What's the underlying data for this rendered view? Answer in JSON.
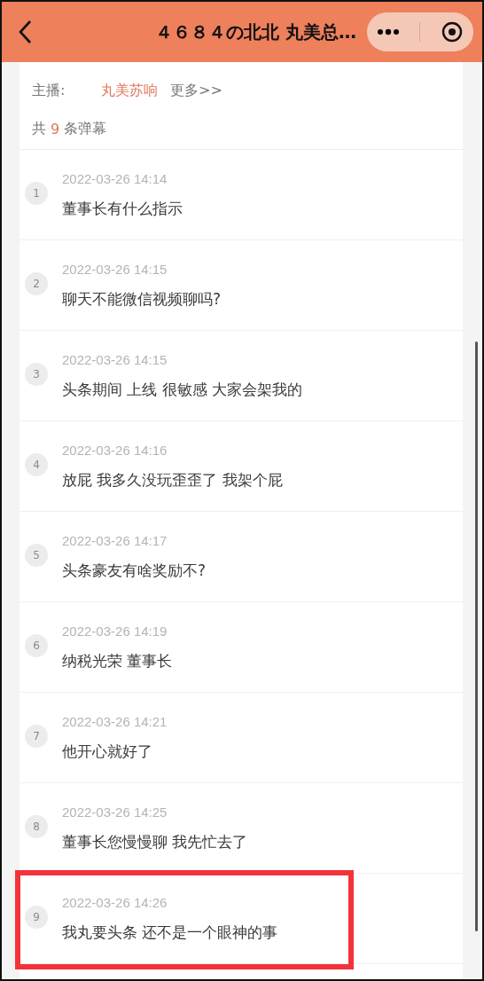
{
  "header": {
    "title": "４６８４の北北 丸美总…"
  },
  "info": {
    "host_label": "主播:",
    "host_name": "丸美苏响",
    "more": "更多>>",
    "count_prefix": "共",
    "count": "9",
    "count_suffix": "条弹幕"
  },
  "comments": [
    {
      "index": "1",
      "time": "2022-03-26 14:14",
      "text": "董事长有什么指示",
      "highlighted": false
    },
    {
      "index": "2",
      "time": "2022-03-26 14:15",
      "text": "聊天不能微信视频聊吗?",
      "highlighted": false
    },
    {
      "index": "3",
      "time": "2022-03-26 14:15",
      "text": "头条期间 上线 很敏感 大家会架我的",
      "highlighted": false
    },
    {
      "index": "4",
      "time": "2022-03-26 14:16",
      "text": "放屁 我多久没玩歪歪了 我架个屁",
      "highlighted": false
    },
    {
      "index": "5",
      "time": "2022-03-26 14:17",
      "text": "头条豪友有啥奖励不?",
      "highlighted": false
    },
    {
      "index": "6",
      "time": "2022-03-26 14:19",
      "text": "纳税光荣 董事长",
      "highlighted": false
    },
    {
      "index": "7",
      "time": "2022-03-26 14:21",
      "text": "他开心就好了",
      "highlighted": false
    },
    {
      "index": "8",
      "time": "2022-03-26 14:25",
      "text": "董事长您慢慢聊 我先忙去了",
      "highlighted": false
    },
    {
      "index": "9",
      "time": "2022-03-26 14:26",
      "text": "我丸要头条 还不是一个眼神的事",
      "highlighted": true
    }
  ]
}
